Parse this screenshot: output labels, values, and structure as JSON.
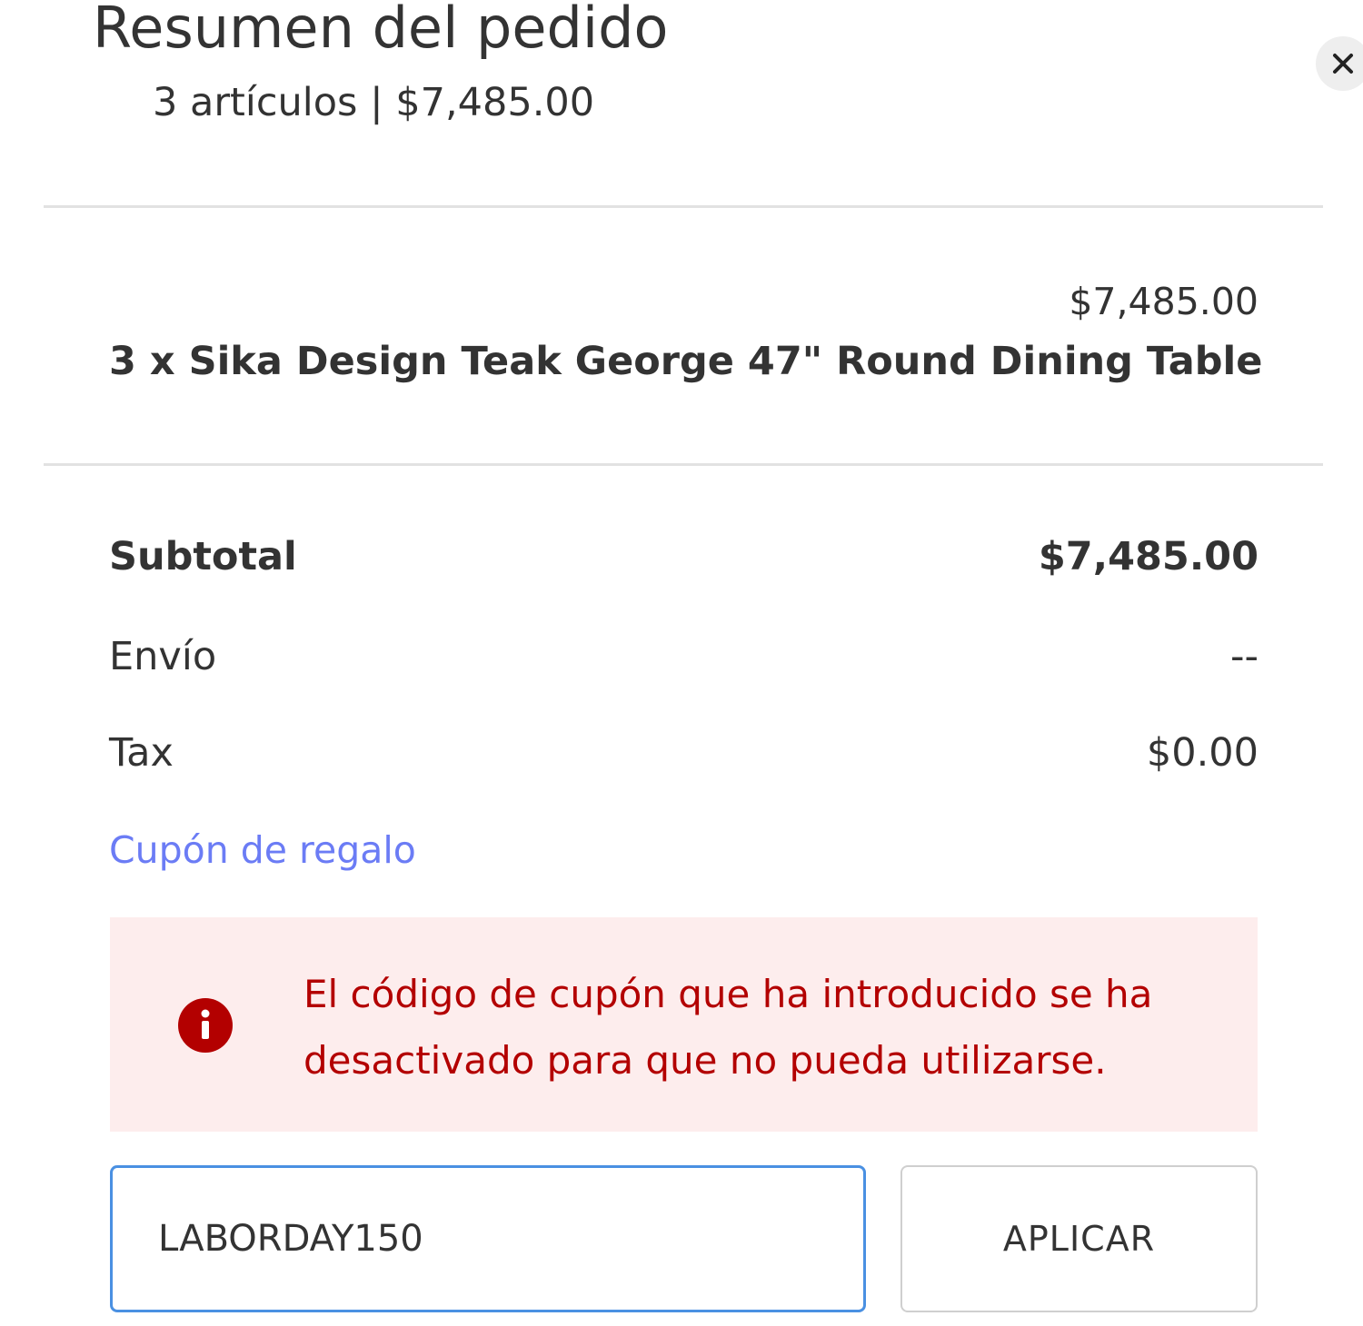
{
  "header": {
    "title": "Resumen del pedido",
    "summary": "3 artículos | $7,485.00"
  },
  "close_icon": "close-icon",
  "item": {
    "price": "$7,485.00",
    "name": "3 x Sika Design Teak George 47\" Round Dining Table"
  },
  "totals": {
    "subtotal_label": "Subtotal",
    "subtotal_value": "$7,485.00",
    "shipping_label": "Envío",
    "shipping_value": "--",
    "tax_label": "Tax",
    "tax_value": "$0.00"
  },
  "coupon": {
    "link_label": "Cupón de regalo",
    "error_message": "El código de cupón que ha introducido se ha desactivado para que no pueda utilizarse.",
    "error_icon": "info-circle-icon",
    "input_value": "LABORDAY150",
    "apply_label": "APLICAR"
  },
  "colors": {
    "link": "#6b7cf5",
    "error_text": "#b30000",
    "error_background": "#fdeded",
    "error_icon": "#b30000",
    "input_focus_border": "#4a90e2"
  }
}
